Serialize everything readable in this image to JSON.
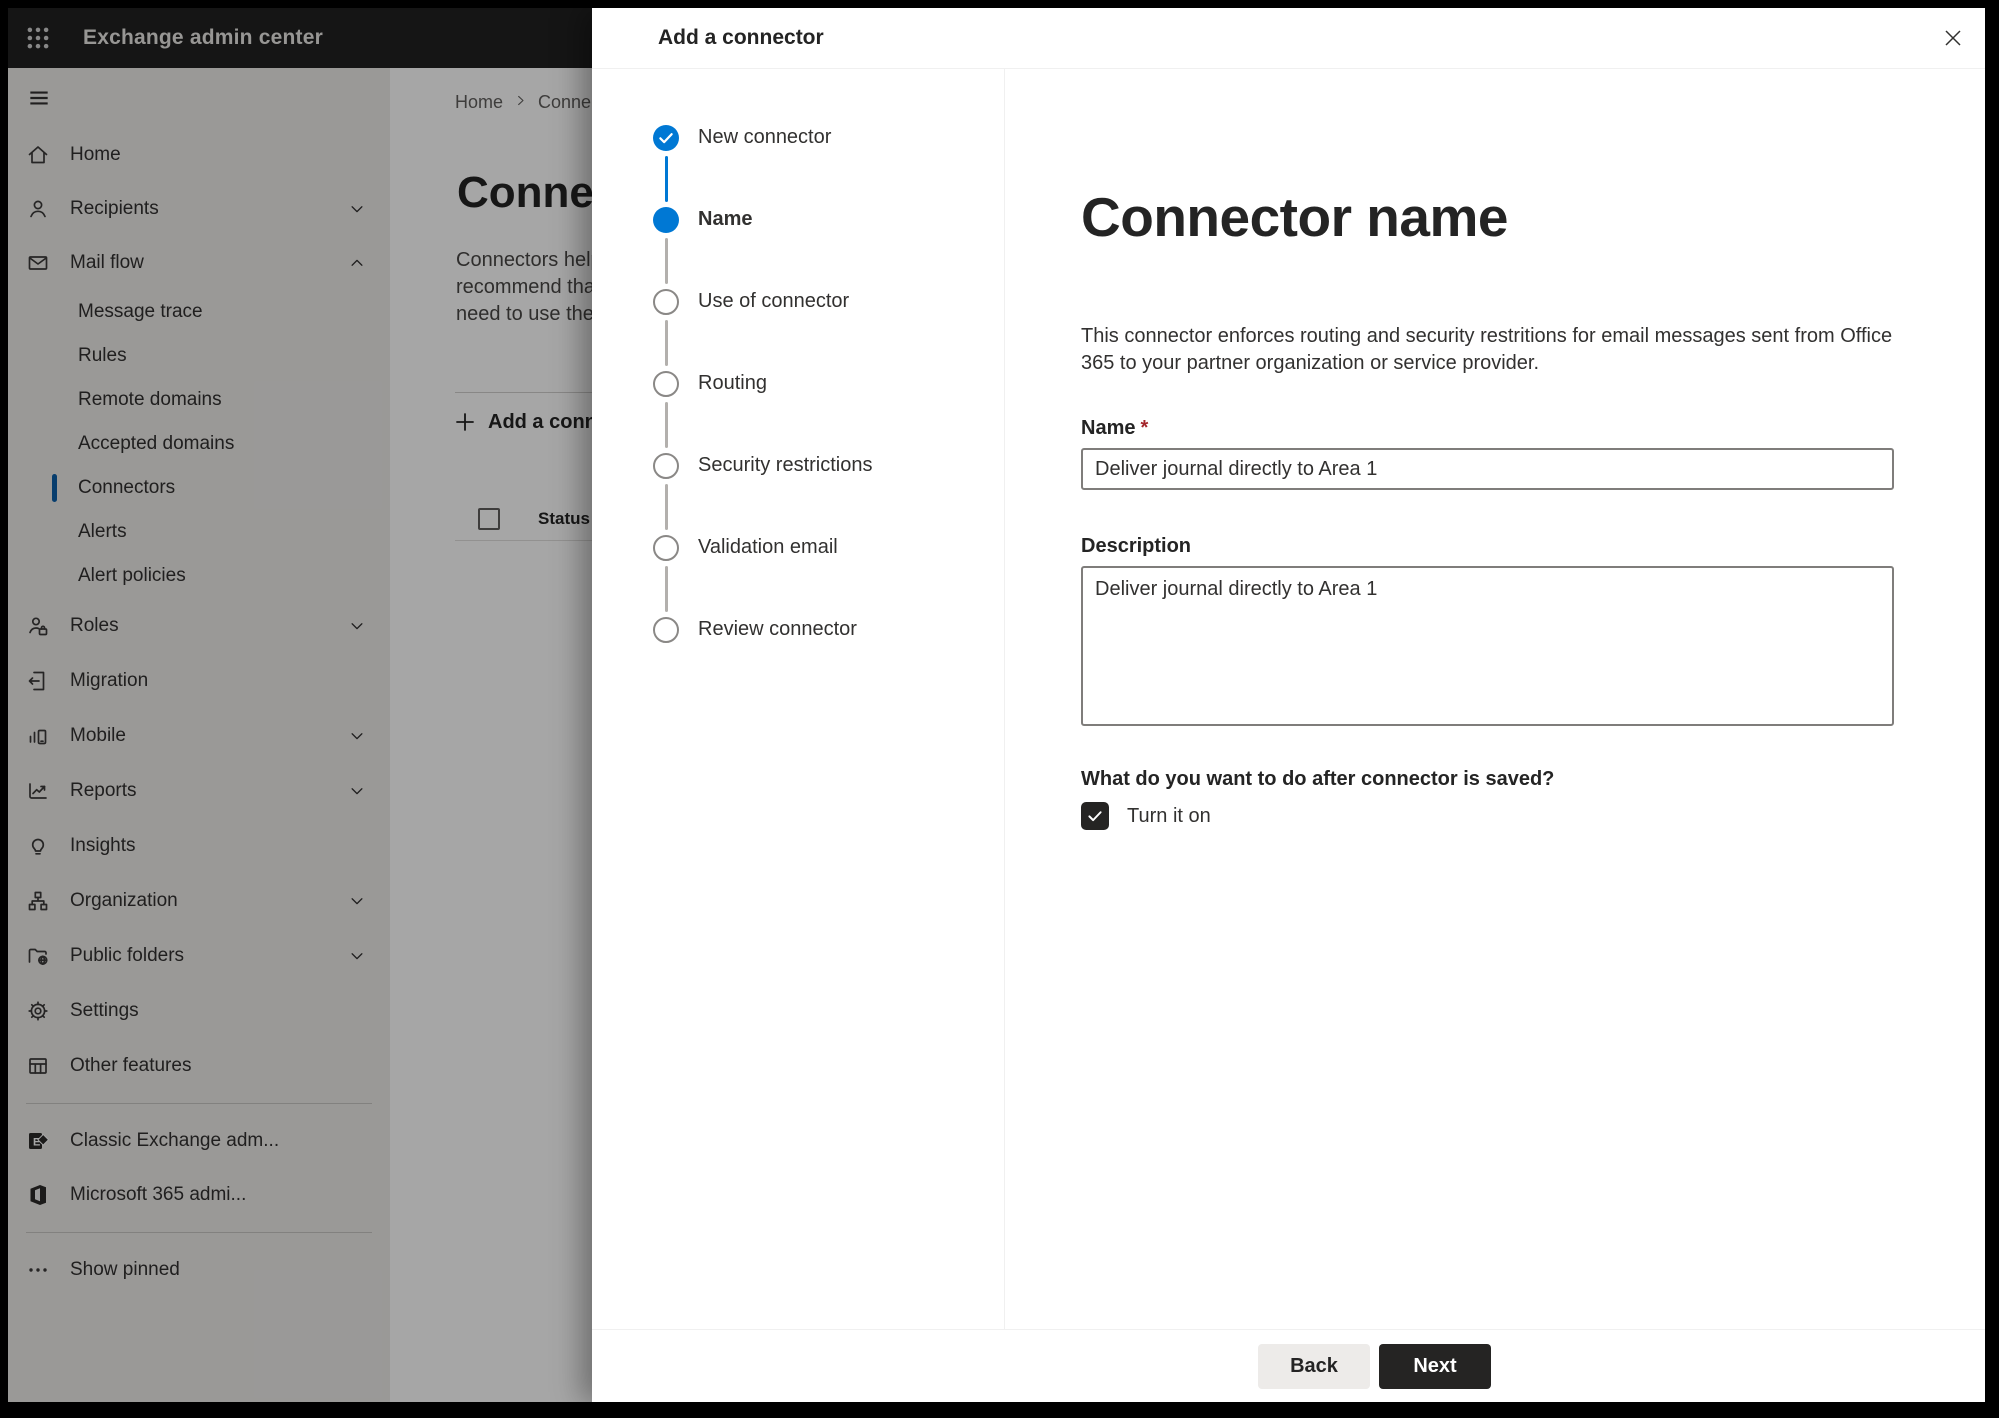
{
  "app_header": {
    "title": "Exchange admin center"
  },
  "sidebar": {
    "items": [
      {
        "label": "Home",
        "icon": "home"
      },
      {
        "label": "Recipients",
        "icon": "person",
        "chevron": "down"
      },
      {
        "label": "Mail flow",
        "icon": "mail",
        "chevron": "up"
      },
      {
        "label": "Message trace",
        "sub": true
      },
      {
        "label": "Rules",
        "sub": true
      },
      {
        "label": "Remote domains",
        "sub": true
      },
      {
        "label": "Accepted domains",
        "sub": true
      },
      {
        "label": "Connectors",
        "sub": true,
        "selected": true
      },
      {
        "label": "Alerts",
        "sub": true
      },
      {
        "label": "Alert policies",
        "sub": true
      },
      {
        "label": "Roles",
        "icon": "roles",
        "chevron": "down",
        "tier2": true
      },
      {
        "label": "Migration",
        "icon": "migration",
        "tier2": true
      },
      {
        "label": "Mobile",
        "icon": "mobile",
        "chevron": "down",
        "tier2": true
      },
      {
        "label": "Reports",
        "icon": "reports",
        "chevron": "down",
        "tier2": true
      },
      {
        "label": "Insights",
        "icon": "insights",
        "tier2": true
      },
      {
        "label": "Organization",
        "icon": "organization",
        "chevron": "down",
        "tier2": true
      },
      {
        "label": "Public folders",
        "icon": "public-folders",
        "chevron": "down",
        "tier2": true
      },
      {
        "label": "Settings",
        "icon": "settings",
        "tier2": true
      },
      {
        "label": "Other features",
        "icon": "other-features",
        "tier2": true
      },
      {
        "divider": true
      },
      {
        "label": "Classic Exchange adm...",
        "icon": "classic-exchange"
      },
      {
        "label": "Microsoft 365 admi...",
        "icon": "m365"
      },
      {
        "divider": true
      },
      {
        "label": "Show pinned",
        "icon": "ellipsis"
      }
    ]
  },
  "page": {
    "breadcrumb": [
      "Home",
      "Conne"
    ],
    "title": "Connect",
    "intro_lines": [
      "Connectors help",
      "recommend tha",
      "need to use ther"
    ],
    "add_button_label": "Add a conn",
    "status_column_label": "Status"
  },
  "dialog": {
    "title": "Add a connector",
    "steps": [
      {
        "label": "New connector",
        "state": "completed"
      },
      {
        "label": "Name",
        "state": "current"
      },
      {
        "label": "Use of connector",
        "state": "upcoming"
      },
      {
        "label": "Routing",
        "state": "upcoming"
      },
      {
        "label": "Security restrictions",
        "state": "upcoming"
      },
      {
        "label": "Validation email",
        "state": "upcoming"
      },
      {
        "label": "Review connector",
        "state": "upcoming"
      }
    ],
    "heading": "Connector name",
    "intro": "This connector enforces routing and security restritions for email messages sent from Office 365 to your partner organization or service provider.",
    "name_field": {
      "label": "Name",
      "required_marker": "*",
      "value": "Deliver journal directly to Area 1"
    },
    "description_field": {
      "label": "Description",
      "value": "Deliver journal directly to Area 1"
    },
    "after_save": {
      "question": "What do you want to do after connector is saved?",
      "checkbox_label": "Turn it on",
      "checked": true
    },
    "footer": {
      "back_label": "Back",
      "next_label": "Next"
    }
  },
  "colors": {
    "accent": "#0078d4",
    "dark_button": "#252423",
    "required_red": "#a4262c"
  }
}
